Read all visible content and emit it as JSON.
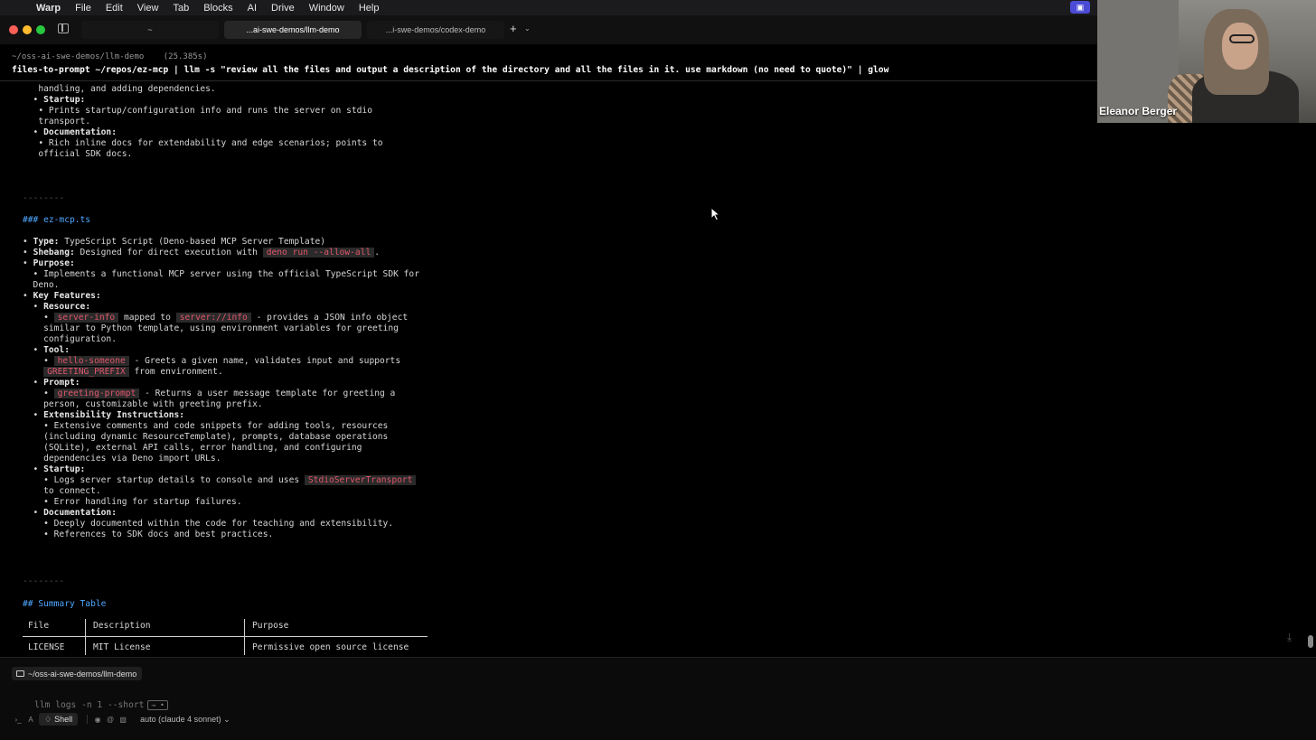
{
  "menubar": {
    "app_name": "Warp",
    "items": [
      "File",
      "Edit",
      "View",
      "Tab",
      "Blocks",
      "AI",
      "Drive",
      "Window",
      "Help"
    ]
  },
  "tabs": [
    {
      "label": "~"
    },
    {
      "label": "...ai-swe-demos/llm-demo"
    },
    {
      "label": "...i-swe-demos/codex-demo"
    }
  ],
  "block": {
    "cwd": "~/oss-ai-swe-demos/llm-demo",
    "duration": "(25.385s)",
    "command": "files-to-prompt ~/repos/ez-mcp | llm -s \"review all the files and output a description of the directory and all the files in it. use markdown (no need to quote)\" | glow"
  },
  "output": {
    "l1": "   handling, and adding dependencies.",
    "l2_label": "Startup:",
    "l3": "   • Prints startup/configuration info and runs the server on stdio",
    "l4": "   transport.",
    "l5_label": "Documentation:",
    "l6": "   • Rich inline docs for extendability and edge scenarios; points to",
    "l7": "   official SDK docs.",
    "rule1": "--------",
    "h3": "### ez-mcp.ts",
    "type_label": "Type:",
    "type_value": " TypeScript Script (Deno-based MCP Server Template)",
    "shebang_label": "Shebang:",
    "shebang_value": " Designed for direct execution with ",
    "shebang_code": "deno run --allow-all",
    "shebang_end": ".",
    "purpose_label": "Purpose:",
    "purpose_1": "  • Implements a functional MCP server using the official TypeScript SDK for",
    "purpose_2": "  Deno.",
    "key_features_label": "Key Features:",
    "resource_label": "Resource:",
    "resource_code1": "server-info",
    "resource_mid": " mapped to ",
    "resource_code2": "server://info",
    "resource_end": " - provides a JSON info object",
    "resource_2": "    similar to Python template, using environment variables for greeting",
    "resource_3": "    configuration.",
    "tool_label": "Tool:",
    "tool_code": "hello-someone",
    "tool_end": " - Greets a given name, validates input and supports",
    "tool_code2": "GREETING_PREFIX",
    "tool_end2": " from environment.",
    "prompt_label": "Prompt:",
    "prompt_code": "greeting-prompt",
    "prompt_end": " - Returns a user message template for greeting a",
    "prompt_2": "    person, customizable with greeting prefix.",
    "ext_label": "Extensibility Instructions:",
    "ext_1": "    • Extensive comments and code snippets for adding tools, resources",
    "ext_2": "    (including dynamic ResourceTemplate), prompts, database operations",
    "ext_3": "    (SQLite), external API calls, error handling, and configuring",
    "ext_4": "    dependencies via Deno import URLs.",
    "startup_label": "Startup:",
    "startup_1": "    • Logs server startup details to console and uses ",
    "startup_code": "StdioServerTransport",
    "startup_2": "    to connect.",
    "startup_3": "    • Error handling for startup failures.",
    "doc_label": "Documentation:",
    "doc_1": "    • Deeply documented within the code for teaching and extensibility.",
    "doc_2": "    • References to SDK docs and best practices.",
    "rule2": "--------",
    "h2": "## Summary Table"
  },
  "summary_table": {
    "headers": [
      "File",
      "Description",
      "Purpose"
    ],
    "rows": [
      [
        "LICENSE",
        "MIT License",
        "Permissive open source license"
      ]
    ]
  },
  "input": {
    "dir_chip": "~/oss-ai-swe-demos/llm-demo",
    "suggestion": "llm logs -n 1 --short",
    "suggestion_key": "→ •",
    "mode": "Shell",
    "model": "auto (claude 4 sonnet)"
  },
  "video": {
    "participant_name": "Eleanor Berger"
  },
  "colors": {
    "heading": "#4ea7ff",
    "inline_code": "#e0566b",
    "screen_share": "#4b4bd6"
  }
}
